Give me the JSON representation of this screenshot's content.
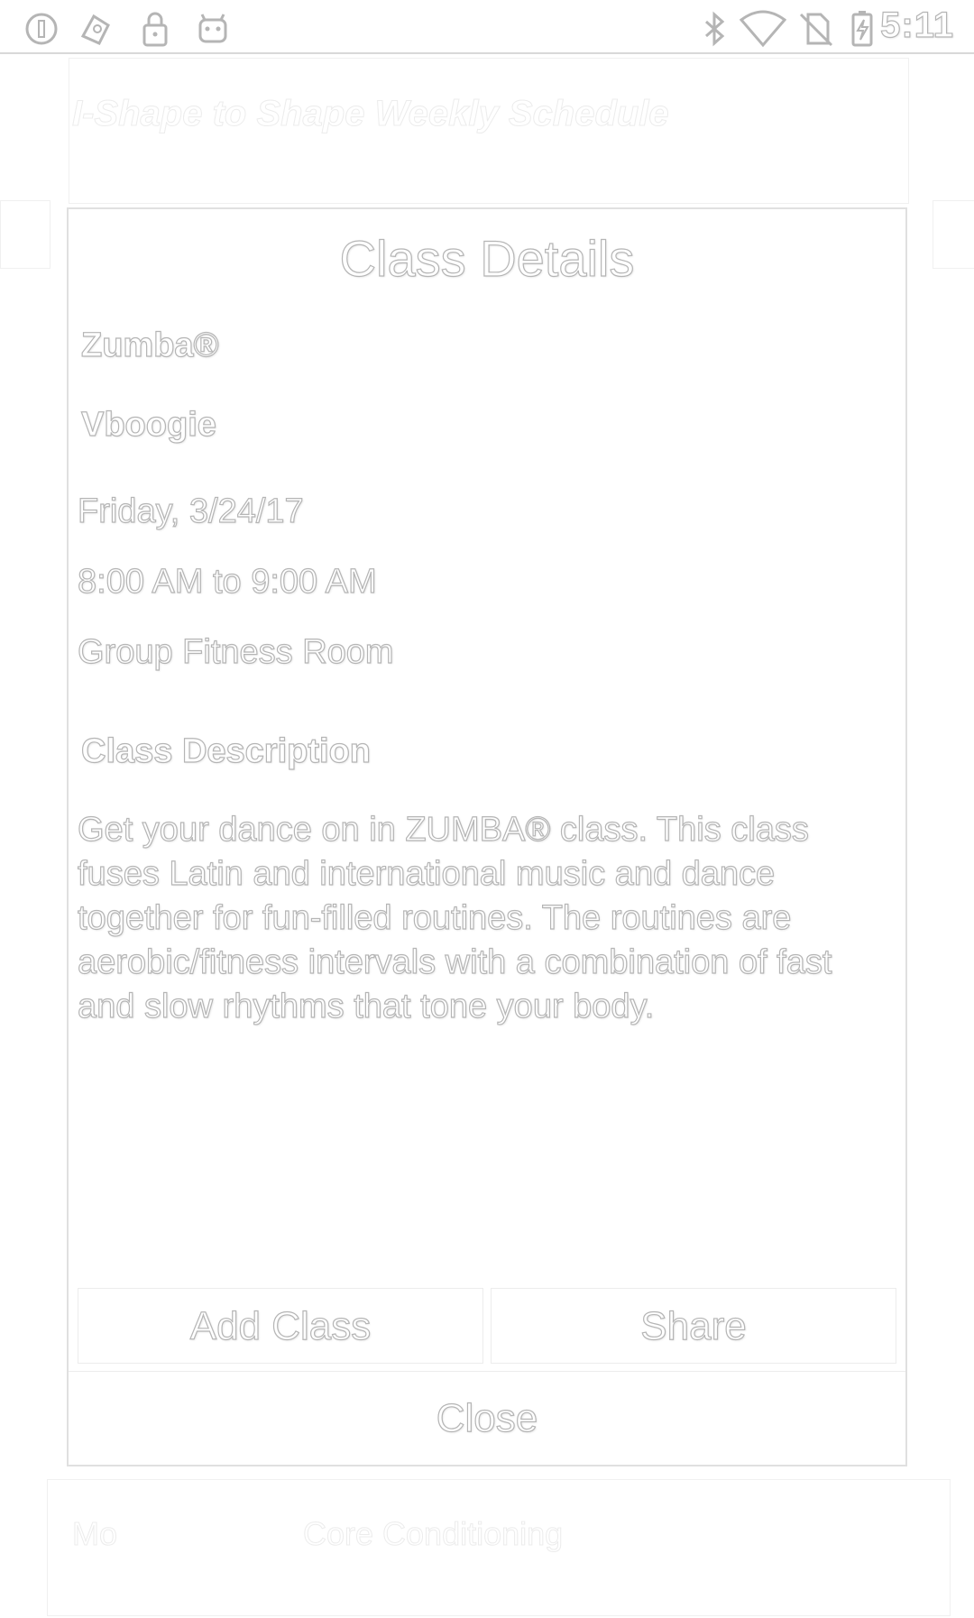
{
  "status_bar": {
    "time": "5:11",
    "left_icons": [
      "circle-info-icon",
      "game-pad-icon",
      "lock-icon",
      "android-icon"
    ],
    "right_icons": [
      "bluetooth-icon",
      "wifi-icon",
      "no-sim-icon",
      "battery-charging-icon"
    ]
  },
  "background": {
    "title": "I-Shape to Shape Weekly Schedule",
    "bottom_left": "Mo",
    "bottom_center": "Core Conditioning"
  },
  "dialog": {
    "title": "Class Details",
    "class_name": "Zumba®",
    "instructor": "Vboogie",
    "date": "Friday, 3/24/17",
    "time": "8:00 AM to 9:00 AM",
    "room": "Group Fitness Room",
    "description_heading": "Class Description",
    "description": "Get your dance on in ZUMBA® class. This class fuses Latin and international music and dance together for fun-filled routines. The routines are aerobic/fitness intervals with a combination of fast and slow rhythms that tone your body.",
    "add_class_label": "Add Class",
    "share_label": "Share",
    "close_label": "Close"
  }
}
